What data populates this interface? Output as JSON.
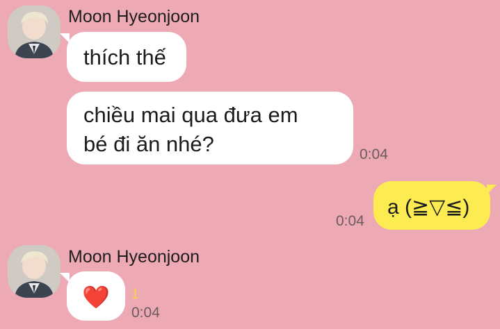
{
  "colors": {
    "background": "#eda9b4",
    "bubble_incoming": "#ffffff",
    "bubble_outgoing": "#fcec52",
    "unread_count": "#f7d63e"
  },
  "messages": [
    {
      "sender": "Moon Hyeonjoon",
      "avatar_icon": "avatar-icon",
      "bubbles": [
        {
          "text": "thích thế"
        },
        {
          "text_line1": "chiều mai qua đưa em",
          "text_line2": "bé đi ăn nhé?",
          "time": "0:04"
        }
      ]
    },
    {
      "outgoing": true,
      "text": "ạ (≧▽≦)",
      "time": "0:04"
    },
    {
      "sender": "Moon Hyeonjoon",
      "avatar_icon": "avatar-icon",
      "bubbles": [
        {
          "text": "❤️",
          "unread": "1",
          "time": "0:04",
          "icon": "heart-icon"
        }
      ]
    }
  ]
}
